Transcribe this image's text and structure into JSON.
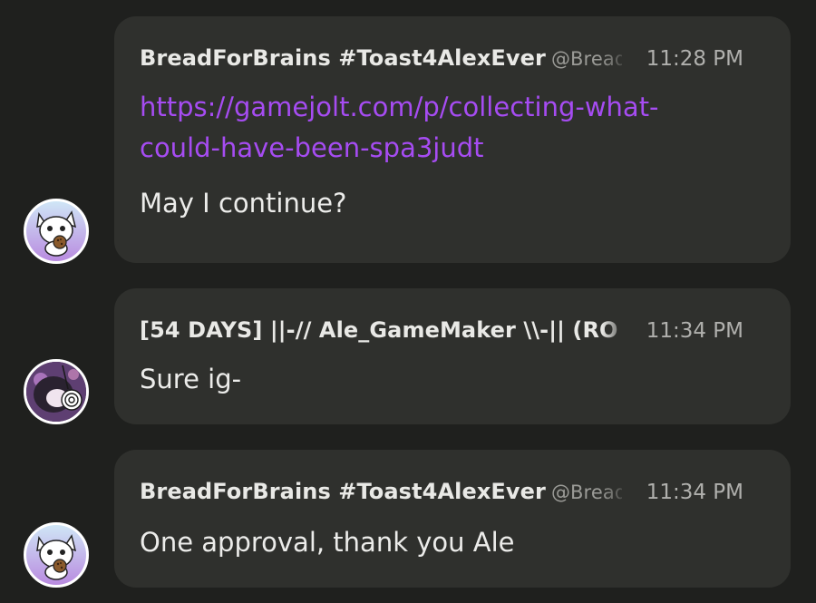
{
  "messages": [
    {
      "author": "BreadForBrains #Toast4AlexEver",
      "handle": "@BreadForBrains",
      "time": "11:28 PM",
      "link": "https://gamejolt.com/p/collecting-what-could-have-been-spa3judt",
      "text": "May I continue?",
      "avatar": "cat-cookie-avatar"
    },
    {
      "author": "[54 DAYS] ||-// Ale_GameMaker \\\\-|| (RO",
      "time": "11:34 PM",
      "text": "Sure ig-",
      "avatar": "purple-spiral-avatar"
    },
    {
      "author": "BreadForBrains #Toast4AlexEver",
      "handle": "@BreadForBrains",
      "time": "11:34 PM",
      "text": "One approval, thank you Ale",
      "avatar": "cat-cookie-avatar"
    }
  ],
  "colors": {
    "background": "#1f201e",
    "bubble": "#2f302d",
    "link": "#a64cf2",
    "name": "#e9e9e6",
    "time": "#b0b0ad"
  }
}
